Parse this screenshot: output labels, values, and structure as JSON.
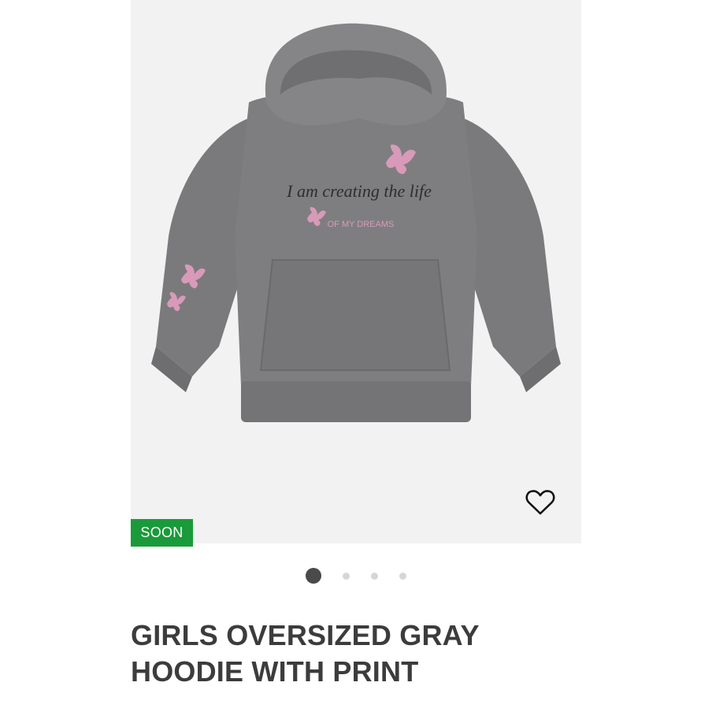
{
  "product": {
    "badge": "SOON",
    "title_line1": "GIRLS OVERSIZED GRAY",
    "title_line2": "HOODIE WITH PRINT",
    "print_script": "I am creating the life",
    "print_caption": "OF MY DREAMS",
    "wishlist_icon": "heart-outline-icon"
  },
  "carousel": {
    "total_slides": 4,
    "active_index": 1
  },
  "colors": {
    "image_bg": "#f2f2f2",
    "badge_bg": "#1a9a3a",
    "hoodie": "#7c7c7e",
    "print_pink": "#d89ab8",
    "title": "#3c3c3c"
  }
}
